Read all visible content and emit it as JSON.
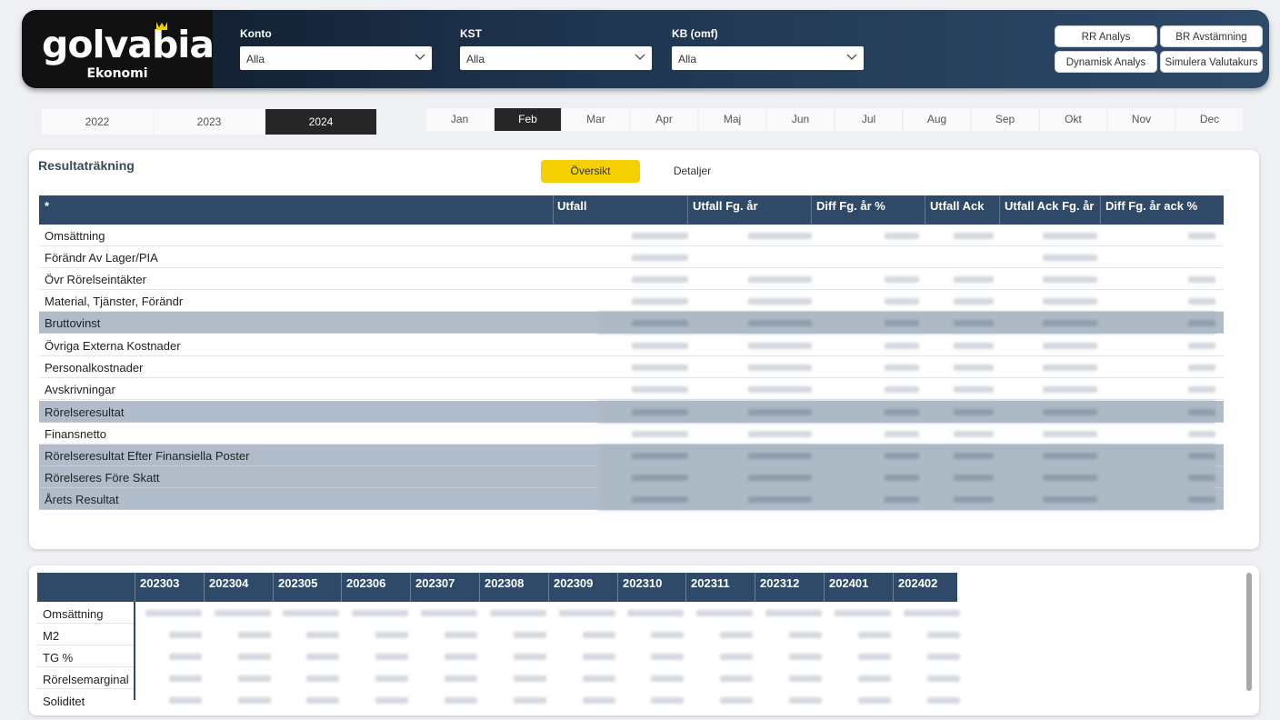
{
  "header": {
    "logo_name": "golvabia",
    "logo_sub": "Ekonomi",
    "filters": [
      {
        "label": "Konto",
        "value": "Alla"
      },
      {
        "label": "KST",
        "value": "Alla"
      },
      {
        "label": "KB (omf)",
        "value": "Alla"
      }
    ],
    "buttons": [
      "RR Analys",
      "BR Avstämning",
      "Dynamisk Analys",
      "Simulera Valutakurs"
    ],
    "accent": "#f5d000"
  },
  "years": [
    "2022",
    "2023",
    "2024"
  ],
  "selected_year": "2024",
  "months": [
    "Jan",
    "Feb",
    "Mar",
    "Apr",
    "Maj",
    "Jun",
    "Jul",
    "Aug",
    "Sep",
    "Okt",
    "Nov",
    "Dec"
  ],
  "selected_month": "Feb",
  "income_statement": {
    "title": "Resultaträkning",
    "tabs": [
      "Översikt",
      "Detaljer"
    ],
    "active_tab": "Översikt",
    "columns": [
      "*",
      "Utfall",
      "Utfall Fg. år",
      "Diff Fg. år %",
      "Utfall Ack",
      "Utfall Ack Fg. år",
      "Diff Fg. år ack %"
    ],
    "rows": [
      {
        "label": "Omsättning",
        "highlight": false
      },
      {
        "label": "Förändr Av Lager/PIA",
        "highlight": false
      },
      {
        "label": "Övr Rörelseintäkter",
        "highlight": false
      },
      {
        "label": "Material, Tjänster, Förändr",
        "highlight": false
      },
      {
        "label": "Bruttovinst",
        "highlight": true
      },
      {
        "label": "Övriga Externa Kostnader",
        "highlight": false
      },
      {
        "label": "Personalkostnader",
        "highlight": false
      },
      {
        "label": "Avskrivningar",
        "highlight": false
      },
      {
        "label": "Rörelseresultat",
        "highlight": true
      },
      {
        "label": "Finansnetto",
        "highlight": false
      },
      {
        "label": "Rörelseresultat Efter Finansiella Poster",
        "highlight": true
      },
      {
        "label": "Rörelseres Före Skatt",
        "highlight": true
      },
      {
        "label": "Årets Resultat",
        "highlight": true
      }
    ]
  },
  "kpi_table": {
    "periods": [
      "202303",
      "202304",
      "202305",
      "202306",
      "202307",
      "202308",
      "202309",
      "202310",
      "202311",
      "202312",
      "202401",
      "202402"
    ],
    "rows": [
      "Omsättning",
      "M2",
      "TG %",
      "Rörelsemarginal",
      "Soliditet"
    ]
  }
}
